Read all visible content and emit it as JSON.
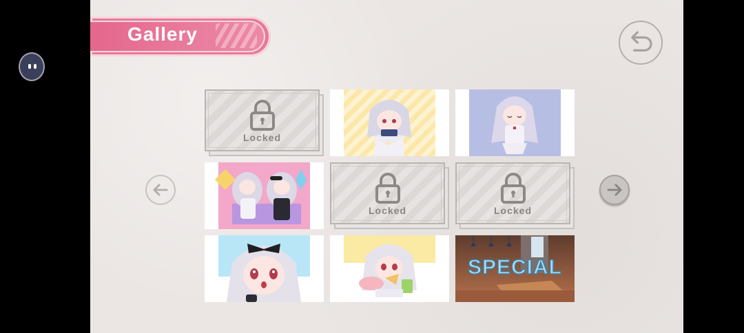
{
  "header": {
    "title": "Gallery"
  },
  "nav": {
    "back_icon": "undo-arrow-icon",
    "prev_icon": "arrow-left-icon",
    "next_icon": "arrow-right-icon"
  },
  "gallery": {
    "locked_label": "Locked",
    "special_label": "SPECIAL",
    "tiles": [
      {
        "state": "locked",
        "label": "Locked"
      },
      {
        "state": "unlocked",
        "scene": "girl-with-game-console"
      },
      {
        "state": "unlocked",
        "scene": "girl-eyes-closed"
      },
      {
        "state": "unlocked",
        "scene": "two-girls-playing"
      },
      {
        "state": "locked",
        "label": "Locked"
      },
      {
        "state": "locked",
        "label": "Locked"
      },
      {
        "state": "unlocked",
        "scene": "girl-black-bow-surprised"
      },
      {
        "state": "unlocked",
        "scene": "girl-eating-snacks"
      },
      {
        "state": "unlocked",
        "scene": "special-room",
        "label": "SPECIAL"
      }
    ]
  },
  "colors": {
    "accent": "#e8799a",
    "background": "#ebe6e4"
  }
}
